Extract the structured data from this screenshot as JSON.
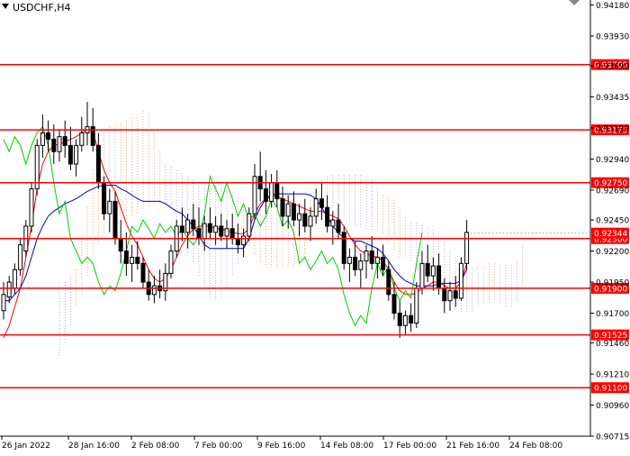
{
  "window": {
    "title": "USDCHF,H4"
  },
  "colors": {
    "background": "#ffffff",
    "axis": "#000000",
    "level": "#ff0000",
    "level_badge": "#ff0000",
    "level_badge_text": "#ffffff",
    "candle": "#000000",
    "tenkan": "#ff0000",
    "kijun": "#0000c8",
    "chikou": "#00cc00",
    "cloud_a": "#e8a070",
    "cloud_b": "#b8a0d0"
  },
  "chart_data": {
    "type": "candlestick",
    "symbol": "USDCHF",
    "timeframe": "H4",
    "ylim": [
      0.9071,
      0.9422
    ],
    "price_ticks": [
      0.9418,
      0.9393,
      0.9369,
      0.9344,
      0.9319,
      0.9294,
      0.9269,
      0.9245,
      0.922,
      0.9195,
      0.917,
      0.9146,
      0.9121,
      0.9096,
      0.9071
    ],
    "price_tick_labels": [
      "0.94180",
      "0.93930",
      "0.93690",
      "0.93435",
      "0.93190",
      "0.92940",
      "0.92690",
      "0.92450",
      "0.92200",
      "0.91950",
      "0.91700",
      "0.91460",
      "0.91210",
      "0.90960",
      "0.90715"
    ],
    "x_labels": [
      "26 Jan 2022",
      "28 Jan 16:00",
      "2 Feb 08:00",
      "7 Feb 00:00",
      "9 Feb 16:00",
      "14 Feb 08:00",
      "17 Feb 00:00",
      "21 Feb 16:00",
      "24 Feb 08:00"
    ],
    "levels": [
      {
        "value": 0.937,
        "label": "0.93700"
      },
      {
        "value": 0.93175,
        "label": "0.93175"
      },
      {
        "value": 0.9275,
        "label": "0.92750"
      },
      {
        "value": 0.923,
        "label": "0.92300"
      },
      {
        "value": 0.919,
        "label": "0.91900"
      },
      {
        "value": 0.91525,
        "label": "0.91525"
      },
      {
        "value": 0.911,
        "label": "0.91100"
      }
    ],
    "current_price": {
      "value": 0.92344,
      "label": "0.92344"
    },
    "candles": [
      [
        0.9172,
        0.9195,
        0.9165,
        0.9185
      ],
      [
        0.9183,
        0.92,
        0.9178,
        0.9195
      ],
      [
        0.919,
        0.921,
        0.9185,
        0.9205
      ],
      [
        0.9205,
        0.923,
        0.92,
        0.9225
      ],
      [
        0.922,
        0.9245,
        0.9215,
        0.924
      ],
      [
        0.924,
        0.9275,
        0.9235,
        0.927
      ],
      [
        0.927,
        0.931,
        0.9265,
        0.9305
      ],
      [
        0.9305,
        0.933,
        0.9295,
        0.9315
      ],
      [
        0.9315,
        0.9325,
        0.93,
        0.931
      ],
      [
        0.931,
        0.9322,
        0.929,
        0.93
      ],
      [
        0.93,
        0.9318,
        0.9292,
        0.9312
      ],
      [
        0.9312,
        0.9325,
        0.9295,
        0.9305
      ],
      [
        0.9305,
        0.932,
        0.9285,
        0.929
      ],
      [
        0.929,
        0.931,
        0.928,
        0.9305
      ],
      [
        0.9305,
        0.9328,
        0.93,
        0.9315
      ],
      [
        0.9315,
        0.934,
        0.9305,
        0.932
      ],
      [
        0.932,
        0.9335,
        0.93,
        0.9305
      ],
      [
        0.9305,
        0.9315,
        0.927,
        0.9275
      ],
      [
        0.9275,
        0.928,
        0.9245,
        0.925
      ],
      [
        0.925,
        0.927,
        0.9235,
        0.926
      ],
      [
        0.926,
        0.9268,
        0.9225,
        0.923
      ],
      [
        0.923,
        0.9245,
        0.921,
        0.922
      ],
      [
        0.922,
        0.9235,
        0.92,
        0.921
      ],
      [
        0.921,
        0.9225,
        0.9195,
        0.9215
      ],
      [
        0.9215,
        0.9228,
        0.9205,
        0.921
      ],
      [
        0.921,
        0.9215,
        0.919,
        0.9195
      ],
      [
        0.9195,
        0.9205,
        0.918,
        0.9185
      ],
      [
        0.9185,
        0.92,
        0.9178,
        0.9192
      ],
      [
        0.9192,
        0.9205,
        0.9182,
        0.9188
      ],
      [
        0.9188,
        0.921,
        0.918,
        0.9202
      ],
      [
        0.9202,
        0.9225,
        0.9198,
        0.922
      ],
      [
        0.922,
        0.9245,
        0.9215,
        0.924
      ],
      [
        0.924,
        0.9255,
        0.9228,
        0.9235
      ],
      [
        0.9235,
        0.925,
        0.9222,
        0.9245
      ],
      [
        0.9245,
        0.9258,
        0.9232,
        0.9238
      ],
      [
        0.9238,
        0.9255,
        0.9225,
        0.923
      ],
      [
        0.923,
        0.9248,
        0.922,
        0.9242
      ],
      [
        0.9242,
        0.9255,
        0.923,
        0.9235
      ],
      [
        0.9235,
        0.9248,
        0.9225,
        0.924
      ],
      [
        0.924,
        0.925,
        0.9228,
        0.9232
      ],
      [
        0.9232,
        0.9245,
        0.9222,
        0.9238
      ],
      [
        0.9238,
        0.925,
        0.9225,
        0.923
      ],
      [
        0.923,
        0.9242,
        0.9218,
        0.9225
      ],
      [
        0.9225,
        0.9238,
        0.9215,
        0.9232
      ],
      [
        0.9232,
        0.9255,
        0.9228,
        0.925
      ],
      [
        0.925,
        0.929,
        0.9245,
        0.928
      ],
      [
        0.928,
        0.93,
        0.926,
        0.927
      ],
      [
        0.927,
        0.9285,
        0.925,
        0.926
      ],
      [
        0.926,
        0.9282,
        0.9255,
        0.9275
      ],
      [
        0.9275,
        0.9285,
        0.9255,
        0.9262
      ],
      [
        0.9262,
        0.9272,
        0.924,
        0.9248
      ],
      [
        0.9248,
        0.9265,
        0.9238,
        0.9258
      ],
      [
        0.9258,
        0.9268,
        0.924,
        0.9245
      ],
      [
        0.9245,
        0.9258,
        0.9232,
        0.925
      ],
      [
        0.925,
        0.9262,
        0.9235,
        0.924
      ],
      [
        0.924,
        0.9255,
        0.9228,
        0.9248
      ],
      [
        0.9248,
        0.927,
        0.9242,
        0.9262
      ],
      [
        0.9262,
        0.9275,
        0.9245,
        0.9255
      ],
      [
        0.9255,
        0.9265,
        0.9235,
        0.924
      ],
      [
        0.924,
        0.9252,
        0.9225,
        0.9245
      ],
      [
        0.9245,
        0.9258,
        0.923,
        0.9235
      ],
      [
        0.9235,
        0.924,
        0.9205,
        0.921
      ],
      [
        0.921,
        0.9222,
        0.9195,
        0.9215
      ],
      [
        0.9215,
        0.9228,
        0.92,
        0.9205
      ],
      [
        0.9205,
        0.9218,
        0.919,
        0.9212
      ],
      [
        0.9212,
        0.9225,
        0.9198,
        0.922
      ],
      [
        0.922,
        0.9232,
        0.9205,
        0.921
      ],
      [
        0.921,
        0.9222,
        0.9198,
        0.9215
      ],
      [
        0.9215,
        0.9225,
        0.92,
        0.9205
      ],
      [
        0.9205,
        0.9212,
        0.918,
        0.9185
      ],
      [
        0.9185,
        0.9195,
        0.9165,
        0.917
      ],
      [
        0.917,
        0.918,
        0.915,
        0.916
      ],
      [
        0.916,
        0.9172,
        0.9152,
        0.9168
      ],
      [
        0.9168,
        0.9178,
        0.9155,
        0.9162
      ],
      [
        0.9162,
        0.9195,
        0.9158,
        0.919
      ],
      [
        0.919,
        0.922,
        0.9185,
        0.921
      ],
      [
        0.921,
        0.9225,
        0.9195,
        0.92
      ],
      [
        0.92,
        0.9215,
        0.9188,
        0.9208
      ],
      [
        0.9208,
        0.9218,
        0.9185,
        0.919
      ],
      [
        0.919,
        0.9198,
        0.917,
        0.918
      ],
      [
        0.918,
        0.9195,
        0.9172,
        0.9188
      ],
      [
        0.9188,
        0.92,
        0.9175,
        0.9182
      ],
      [
        0.9182,
        0.9215,
        0.918,
        0.921
      ],
      [
        0.921,
        0.9245,
        0.9205,
        0.9235
      ]
    ],
    "tenkan": [
      0.915,
      0.916,
      0.9175,
      0.919,
      0.9215,
      0.924,
      0.927,
      0.929,
      0.93,
      0.9305,
      0.9306,
      0.9308,
      0.931,
      0.9312,
      0.9315,
      0.9318,
      0.9316,
      0.93,
      0.9285,
      0.9275,
      0.9268,
      0.9255,
      0.9242,
      0.9232,
      0.9225,
      0.9215,
      0.9205,
      0.9198,
      0.9195,
      0.9198,
      0.9205,
      0.9215,
      0.9225,
      0.9232,
      0.9238,
      0.924,
      0.924,
      0.924,
      0.9238,
      0.9238,
      0.9236,
      0.9235,
      0.9234,
      0.9234,
      0.9238,
      0.925,
      0.9258,
      0.9262,
      0.9264,
      0.9264,
      0.9262,
      0.926,
      0.9258,
      0.9256,
      0.9254,
      0.9252,
      0.9252,
      0.9252,
      0.925,
      0.9248,
      0.9246,
      0.924,
      0.9232,
      0.9225,
      0.922,
      0.9218,
      0.9216,
      0.9215,
      0.9212,
      0.9205,
      0.9195,
      0.9188,
      0.9185,
      0.9185,
      0.9186,
      0.919,
      0.9192,
      0.9195,
      0.9195,
      0.9192,
      0.919,
      0.919,
      0.9195,
      0.921
    ],
    "kijun": [
      0.918,
      0.918,
      0.9185,
      0.919,
      0.92,
      0.9215,
      0.923,
      0.924,
      0.9248,
      0.9252,
      0.9255,
      0.9258,
      0.926,
      0.9262,
      0.9265,
      0.9268,
      0.927,
      0.9272,
      0.9273,
      0.9273,
      0.9273,
      0.927,
      0.9268,
      0.9265,
      0.9262,
      0.926,
      0.926,
      0.926,
      0.926,
      0.9258,
      0.9255,
      0.9252,
      0.925,
      0.9245,
      0.924,
      0.9232,
      0.9225,
      0.9222,
      0.9222,
      0.9222,
      0.9222,
      0.9222,
      0.9222,
      0.9222,
      0.923,
      0.9245,
      0.9255,
      0.9262,
      0.9265,
      0.9266,
      0.9266,
      0.9266,
      0.9266,
      0.9266,
      0.9266,
      0.9265,
      0.9262,
      0.9255,
      0.9248,
      0.924,
      0.9235,
      0.923,
      0.923,
      0.9228,
      0.9228,
      0.9226,
      0.9224,
      0.9222,
      0.9218,
      0.9212,
      0.9205,
      0.92,
      0.9196,
      0.9194,
      0.9192,
      0.9192,
      0.9192,
      0.9192,
      0.9194,
      0.9194,
      0.9194,
      0.9194,
      0.9196,
      0.9205
    ]
  }
}
